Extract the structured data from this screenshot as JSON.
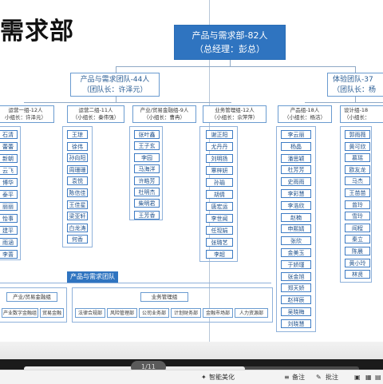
{
  "title": "需求部",
  "root": {
    "line1": "产品与需求部-82人",
    "line2": "（总经理：彭总）"
  },
  "team_left": {
    "line1": "产品与需求团队-44人",
    "line2": "（团队长：许泽元）"
  },
  "team_right": {
    "line1": "体验团队-37",
    "line2": "（团队长：杨"
  },
  "groups": [
    {
      "line1": "运营一组-12人",
      "line2": "小组长：许泽元）",
      "members": [
        "石清",
        "蕾蕾",
        "新朝",
        "云飞",
        "博华",
        "泰平",
        "丽丽",
        "怡事",
        "建平",
        "雨涵",
        "李蔷"
      ]
    },
    {
      "line1": "运营二组-11人",
      "line2": "（小组长：秦伟强）",
      "members": [
        "王琼",
        "徐伟",
        "孙向阳",
        "周珊珊",
        "袁悦",
        "陈信佳",
        "王佳星",
        "梁亚轩",
        "白龙涛",
        "何香"
      ]
    },
    {
      "line1": "产业/贸易金融组-9人",
      "line2": "（小组长：曹冉）",
      "members": [
        "张叶鑫",
        "王子玄",
        "李园",
        "马海洋",
        "许皓芳",
        "杜明杰",
        "柴明君",
        "王芳香"
      ]
    },
    {
      "line1": "业务管理组-12人",
      "line2": "（小组长：佘萍萍）",
      "members": [
        "谢正阳",
        "尤丹丹",
        "刘明扬",
        "覃梓妍",
        "孙瑜",
        "胡倩",
        "唐宏运",
        "李世闻",
        "任现娟",
        "张璐艺",
        "李超"
      ]
    },
    {
      "line1": "产品组-18人",
      "line2": "（小组长：杨洁）",
      "members": [
        "李云丽",
        "杨晶",
        "潘思颖",
        "杜芳芳",
        "史雨雨",
        "李彩慧",
        "李浩欣",
        "赵楠",
        "申熙婧",
        "张欣",
        "金美玉",
        "于娇瑾",
        "张金旭",
        "郑天娇",
        "赵祥辰",
        "吴晓梅",
        "刘晓慧"
      ]
    },
    {
      "line1": "设计组-18",
      "line2": "（小组长：",
      "members": [
        "郭雨薇",
        "黄可欣",
        "慕瑶",
        "欧友龙",
        "马杰",
        "王苗苗",
        "曾玲",
        "雪玲",
        "阎程",
        "秦立",
        "陈晨",
        "黄小玲",
        "林贤"
      ]
    }
  ],
  "bottom": {
    "tag": "产品与需求团队",
    "left_header": "产业/贸易金融组",
    "left_items": [
      "产业数字金融组",
      "贸易金融"
    ],
    "right_header": "业务管理组",
    "right_items": [
      "法律合规部",
      "风险管理部",
      "公司业务部",
      "计划财务部",
      "金融市场部",
      "人力资源部"
    ]
  },
  "viewer": {
    "page_indicator": "1/11",
    "progress": 0.66,
    "toolbar": [
      "智能美化",
      "备注",
      "批注"
    ]
  }
}
